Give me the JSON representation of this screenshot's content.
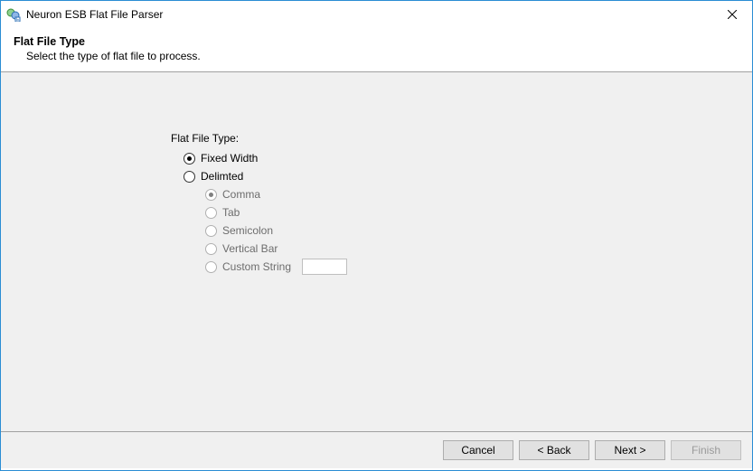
{
  "window": {
    "title": "Neuron ESB Flat File Parser"
  },
  "header": {
    "title": "Flat File Type",
    "subtitle": "Select the type of flat file to process."
  },
  "form": {
    "group_label": "Flat File Type:",
    "main_options": [
      {
        "label": "Fixed Width",
        "checked": true
      },
      {
        "label": "Delimted",
        "checked": false
      }
    ],
    "delimiter_options": [
      {
        "label": "Comma",
        "checked": true
      },
      {
        "label": "Tab",
        "checked": false
      },
      {
        "label": "Semicolon",
        "checked": false
      },
      {
        "label": "Vertical Bar",
        "checked": false
      },
      {
        "label": "Custom String",
        "checked": false
      }
    ],
    "custom_string_value": ""
  },
  "footer": {
    "cancel": "Cancel",
    "back": "< Back",
    "next": "Next >",
    "finish": "Finish"
  }
}
